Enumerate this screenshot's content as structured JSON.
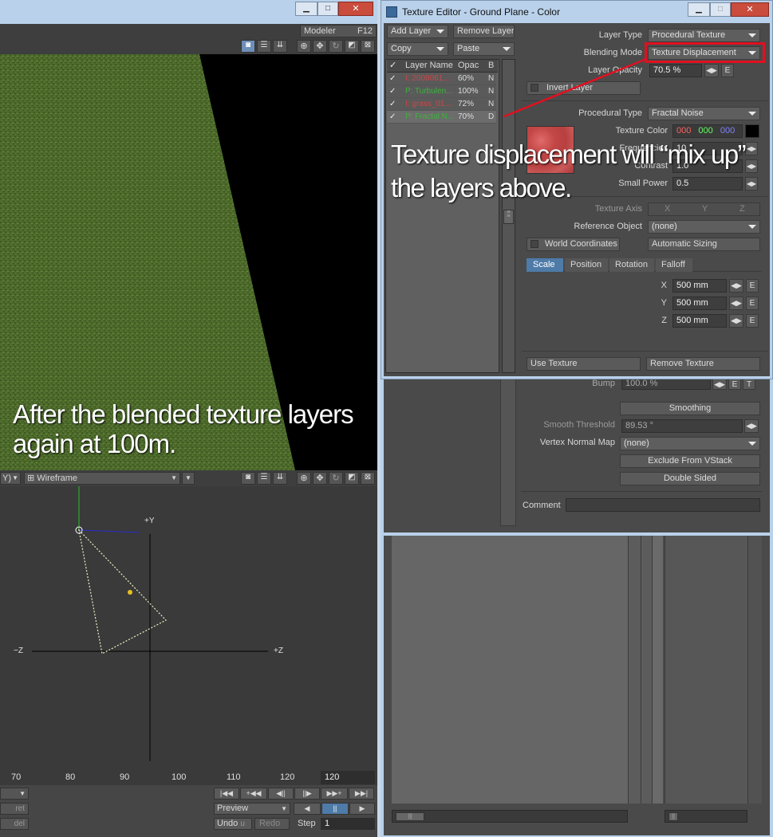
{
  "viewport_top": {
    "modeler_label": "Modeler",
    "modeler_key": "F12",
    "overlay_caption_line1": "After the blended texture layers",
    "overlay_caption_line2": "again at 100m."
  },
  "viewport_bottom": {
    "view_partial": "Y)",
    "view_mode": "Wireframe",
    "axis_plus_y": "+Y",
    "axis_minus_z": "−Z",
    "axis_plus_z": "+Z"
  },
  "timeline": {
    "ticks": [
      "70",
      "80",
      "90",
      "100",
      "110",
      "120"
    ],
    "current_frame": "120",
    "ret_label": "ret",
    "del_label": "del",
    "preview_label": "Preview",
    "undo_label": "Undo",
    "undo_key": "u",
    "redo_label": "Redo",
    "step_label": "Step",
    "step_value": "1"
  },
  "texture_editor": {
    "title": "Texture Editor - Ground Plane - Color",
    "add_layer": "Add Layer",
    "remove_layer": "Remove Layer",
    "copy": "Copy",
    "paste": "Paste",
    "layer_list": {
      "headers": [
        "Layer Name",
        "Opac",
        "B"
      ],
      "rows": [
        {
          "name": "I: 2008061...",
          "opacity": "60%",
          "blend": "N",
          "color": "#c84848"
        },
        {
          "name": "P: Turbulen...",
          "opacity": "100%",
          "blend": "N",
          "color": "#3cb43c"
        },
        {
          "name": "I: grass_01...",
          "opacity": "72%",
          "blend": "N",
          "color": "#c84848"
        },
        {
          "name": "P: Fractal N...",
          "opacity": "70%",
          "blend": "D",
          "color": "#3cb43c"
        }
      ]
    },
    "layer_type_label": "Layer Type",
    "layer_type_value": "Procedural Texture",
    "blending_mode_label": "Blending Mode",
    "blending_mode_value": "Texture Displacement",
    "layer_opacity_label": "Layer Opacity",
    "layer_opacity_value": "70.5 %",
    "invert_layer": "Invert Layer",
    "procedural_type_label": "Procedural Type",
    "procedural_type_value": "Fractal Noise",
    "texture_color_label": "Texture Color",
    "texture_color_r": "000",
    "texture_color_g": "000",
    "texture_color_b": "000",
    "frequencies_label": "Frequencies",
    "frequencies_value": "10",
    "contrast_label": "Contrast",
    "contrast_value": "1.0",
    "small_power_label": "Small Power",
    "small_power_value": "0.5",
    "texture_axis_label": "Texture Axis",
    "axis_x": "X",
    "axis_y": "Y",
    "axis_z": "Z",
    "reference_object_label": "Reference Object",
    "reference_object_value": "(none)",
    "world_coordinates": "World Coordinates",
    "automatic_sizing": "Automatic Sizing",
    "tabs": [
      "Scale",
      "Position",
      "Rotation",
      "Falloff"
    ],
    "scale_x_label": "X",
    "scale_x": "500 mm",
    "scale_y_label": "Y",
    "scale_y": "500 mm",
    "scale_z_label": "Z",
    "scale_z": "500 mm",
    "use_texture": "Use Texture",
    "remove_texture": "Remove Texture",
    "annotation_line1": "Texture displacement will “mix up”",
    "annotation_line2": "the layers above."
  },
  "surface_editor": {
    "bump_label": "Bump",
    "bump_value": "100.0 %",
    "smoothing": "Smoothing",
    "smooth_threshold_label": "Smooth Threshold",
    "smooth_threshold_value": "89.53 °",
    "vertex_normal_map_label": "Vertex Normal Map",
    "vertex_normal_map_value": "(none)",
    "exclude_from_vstack": "Exclude From VStack",
    "double_sided": "Double Sided",
    "comment_label": "Comment"
  },
  "edit_btn": "E",
  "colors": {
    "highlight_red": "#e01020",
    "tab_active": "#4e7ba8",
    "grass": "#4d6a2c"
  }
}
